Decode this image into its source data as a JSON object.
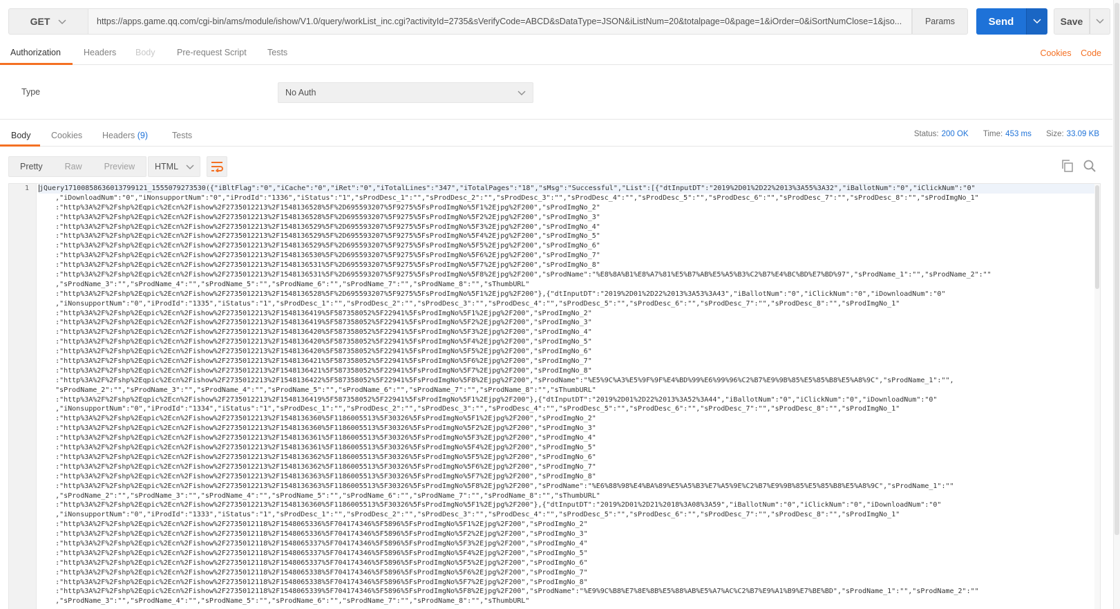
{
  "request": {
    "method": "GET",
    "url": "https://apps.game.qq.com/cgi-bin/ams/module/ishow/V1.0/query/workList_inc.cgi?activityId=2735&sVerifyCode=ABCD&sDataType=JSON&iListNum=20&totalpage=0&page=1&iOrder=0&iSortNumClose=1&jso...",
    "params_label": "Params",
    "send_label": "Send",
    "save_label": "Save"
  },
  "request_tabs": {
    "authorization": "Authorization",
    "headers": "Headers",
    "body": "Body",
    "prerequest": "Pre-request Script",
    "tests": "Tests",
    "cookies_link": "Cookies",
    "code_link": "Code"
  },
  "auth": {
    "type_label": "Type",
    "type_value": "No Auth"
  },
  "response_tabs": {
    "body": "Body",
    "cookies": "Cookies",
    "headers": "Headers",
    "headers_count": "(9)",
    "tests": "Tests"
  },
  "status": {
    "status_label": "Status:",
    "status_value": "200 OK",
    "time_label": "Time:",
    "time_value": "453 ms",
    "size_label": "Size:",
    "size_value": "33.09 KB"
  },
  "view": {
    "pretty": "Pretty",
    "raw": "Raw",
    "preview": "Preview",
    "language": "HTML"
  },
  "editor": {
    "line_number": "1",
    "lines": [
      "jQuery17100858636013799121_1555079273530({\"iBltFlag\":\"0\",\"iCache\":\"0\",\"iRet\":\"0\",\"iTotalLines\":\"347\",\"iTotalPages\":\"18\",\"sMsg\":\"Successful\",\"List\":[{\"dtInputDT\":\"2019%2D01%2D22%2013%3A55%3A32\",\"iBallotNum\":\"0\",\"iClickNum\":\"0\"",
      "    ,\"iDownloadNum\":\"0\",\"iNonsupportNum\":\"0\",\"iProdId\":\"1336\",\"iStatus\":\"1\",\"sProdDesc_1\":\"\",\"sProdDesc_2\":\"\",\"sProdDesc_3\":\"\",\"sProdDesc_4\":\"\",\"sProdDesc_5\":\"\",\"sProdDesc_6\":\"\",\"sProdDesc_7\":\"\",\"sProdDesc_8\":\"\",\"sProdImgNo_1\"",
      "    :\"http%3A%2F%2Fshp%2Eqpic%2Ecn%2Fishow%2F2735012213%2F1548136528%5F%2D695593207%5F9275%5FsProdImgNo%5F1%2Ejpg%2F200\",\"sProdImgNo_2\"",
      "    :\"http%3A%2F%2Fshp%2Eqpic%2Ecn%2Fishow%2F2735012213%2F1548136528%5F%2D695593207%5F9275%5FsProdImgNo%5F2%2Ejpg%2F200\",\"sProdImgNo_3\"",
      "    :\"http%3A%2F%2Fshp%2Eqpic%2Ecn%2Fishow%2F2735012213%2F1548136529%5F%2D695593207%5F9275%5FsProdImgNo%5F3%2Ejpg%2F200\",\"sProdImgNo_4\"",
      "    :\"http%3A%2F%2Fshp%2Eqpic%2Ecn%2Fishow%2F2735012213%2F1548136529%5F%2D695593207%5F9275%5FsProdImgNo%5F4%2Ejpg%2F200\",\"sProdImgNo_5\"",
      "    :\"http%3A%2F%2Fshp%2Eqpic%2Ecn%2Fishow%2F2735012213%2F1548136529%5F%2D695593207%5F9275%5FsProdImgNo%5F5%2Ejpg%2F200\",\"sProdImgNo_6\"",
      "    :\"http%3A%2F%2Fshp%2Eqpic%2Ecn%2Fishow%2F2735012213%2F1548136530%5F%2D695593207%5F9275%5FsProdImgNo%5F6%2Ejpg%2F200\",\"sProdImgNo_7\"",
      "    :\"http%3A%2F%2Fshp%2Eqpic%2Ecn%2Fishow%2F2735012213%2F1548136531%5F%2D695593207%5F9275%5FsProdImgNo%5F7%2Ejpg%2F200\",\"sProdImgNo_8\"",
      "    :\"http%3A%2F%2Fshp%2Eqpic%2Ecn%2Fishow%2F2735012213%2F1548136531%5F%2D695593207%5F9275%5FsProdImgNo%5F8%2Ejpg%2F200\",\"sProdName\":\"%E8%8A%B1%E8%A7%81%E5%B7%AB%E5%A5%B3%C2%B7%E4%BC%BD%E7%BD%97\",\"sProdName_1\":\"\",\"sProdName_2\":\"\"",
      "    ,\"sProdName_3\":\"\",\"sProdName_4\":\"\",\"sProdName_5\":\"\",\"sProdName_6\":\"\",\"sProdName_7\":\"\",\"sProdName_8\":\"\",\"sThumbURL\"",
      "    :\"http%3A%2F%2Fshp%2Eqpic%2Ecn%2Fishow%2F2735012213%2F1548136528%5F%2D695593207%5F9275%5FsProdImgNo%5F1%2Ejpg%2F200\"},{\"dtInputDT\":\"2019%2D01%2D22%2013%3A53%3A43\",\"iBallotNum\":\"0\",\"iClickNum\":\"0\",\"iDownloadNum\":\"0\"",
      "    ,\"iNonsupportNum\":\"0\",\"iProdId\":\"1335\",\"iStatus\":\"1\",\"sProdDesc_1\":\"\",\"sProdDesc_2\":\"\",\"sProdDesc_3\":\"\",\"sProdDesc_4\":\"\",\"sProdDesc_5\":\"\",\"sProdDesc_6\":\"\",\"sProdDesc_7\":\"\",\"sProdDesc_8\":\"\",\"sProdImgNo_1\"",
      "    :\"http%3A%2F%2Fshp%2Eqpic%2Ecn%2Fishow%2F2735012213%2F1548136419%5F587358052%5F22941%5FsProdImgNo%5F1%2Ejpg%2F200\",\"sProdImgNo_2\"",
      "    :\"http%3A%2F%2Fshp%2Eqpic%2Ecn%2Fishow%2F2735012213%2F1548136419%5F587358052%5F22941%5FsProdImgNo%5F2%2Ejpg%2F200\",\"sProdImgNo_3\"",
      "    :\"http%3A%2F%2Fshp%2Eqpic%2Ecn%2Fishow%2F2735012213%2F1548136420%5F587358052%5F22941%5FsProdImgNo%5F3%2Ejpg%2F200\",\"sProdImgNo_4\"",
      "    :\"http%3A%2F%2Fshp%2Eqpic%2Ecn%2Fishow%2F2735012213%2F1548136420%5F587358052%5F22941%5FsProdImgNo%5F4%2Ejpg%2F200\",\"sProdImgNo_5\"",
      "    :\"http%3A%2F%2Fshp%2Eqpic%2Ecn%2Fishow%2F2735012213%2F1548136420%5F587358052%5F22941%5FsProdImgNo%5F5%2Ejpg%2F200\",\"sProdImgNo_6\"",
      "    :\"http%3A%2F%2Fshp%2Eqpic%2Ecn%2Fishow%2F2735012213%2F1548136421%5F587358052%5F22941%5FsProdImgNo%5F6%2Ejpg%2F200\",\"sProdImgNo_7\"",
      "    :\"http%3A%2F%2Fshp%2Eqpic%2Ecn%2Fishow%2F2735012213%2F1548136421%5F587358052%5F22941%5FsProdImgNo%5F7%2Ejpg%2F200\",\"sProdImgNo_8\"",
      "    :\"http%3A%2F%2Fshp%2Eqpic%2Ecn%2Fishow%2F2735012213%2F1548136422%5F587358052%5F22941%5FsProdImgNo%5F8%2Ejpg%2F200\",\"sProdName\":\"%E5%9C%A3%E5%9F%9F%E4%BD%99%E6%99%96%C2%B7%E9%9B%85%E5%85%B8%E5%A8%9C\",\"sProdName_1\":\"\",",
      "    \"sProdName_2\":\"\",\"sProdName_3\":\"\",\"sProdName_4\":\"\",\"sProdName_5\":\"\",\"sProdName_6\":\"\",\"sProdName_7\":\"\",\"sProdName_8\":\"\",\"sThumbURL\"",
      "    :\"http%3A%2F%2Fshp%2Eqpic%2Ecn%2Fishow%2F2735012213%2F1548136419%5F587358052%5F22941%5FsProdImgNo%5F1%2Ejpg%2F200\"},{\"dtInputDT\":\"2019%2D01%2D22%2013%3A52%3A44\",\"iBallotNum\":\"0\",\"iClickNum\":\"0\",\"iDownloadNum\":\"0\"",
      "    ,\"iNonsupportNum\":\"0\",\"iProdId\":\"1334\",\"iStatus\":\"1\",\"sProdDesc_1\":\"\",\"sProdDesc_2\":\"\",\"sProdDesc_3\":\"\",\"sProdDesc_4\":\"\",\"sProdDesc_5\":\"\",\"sProdDesc_6\":\"\",\"sProdDesc_7\":\"\",\"sProdDesc_8\":\"\",\"sProdImgNo_1\"",
      "    :\"http%3A%2F%2Fshp%2Eqpic%2Ecn%2Fishow%2F2735012213%2F1548136360%5F1186005513%5F30326%5FsProdImgNo%5F1%2Ejpg%2F200\",\"sProdImgNo_2\"",
      "    :\"http%3A%2F%2Fshp%2Eqpic%2Ecn%2Fishow%2F2735012213%2F1548136360%5F1186005513%5F30326%5FsProdImgNo%5F2%2Ejpg%2F200\",\"sProdImgNo_3\"",
      "    :\"http%3A%2F%2Fshp%2Eqpic%2Ecn%2Fishow%2F2735012213%2F1548136361%5F1186005513%5F30326%5FsProdImgNo%5F3%2Ejpg%2F200\",\"sProdImgNo_4\"",
      "    :\"http%3A%2F%2Fshp%2Eqpic%2Ecn%2Fishow%2F2735012213%2F1548136361%5F1186005513%5F30326%5FsProdImgNo%5F4%2Ejpg%2F200\",\"sProdImgNo_5\"",
      "    :\"http%3A%2F%2Fshp%2Eqpic%2Ecn%2Fishow%2F2735012213%2F1548136362%5F1186005513%5F30326%5FsProdImgNo%5F5%2Ejpg%2F200\",\"sProdImgNo_6\"",
      "    :\"http%3A%2F%2Fshp%2Eqpic%2Ecn%2Fishow%2F2735012213%2F1548136362%5F1186005513%5F30326%5FsProdImgNo%5F6%2Ejpg%2F200\",\"sProdImgNo_7\"",
      "    :\"http%3A%2F%2Fshp%2Eqpic%2Ecn%2Fishow%2F2735012213%2F1548136363%5F1186005513%5F30326%5FsProdImgNo%5F7%2Ejpg%2F200\",\"sProdImgNo_8\"",
      "    :\"http%3A%2F%2Fshp%2Eqpic%2Ecn%2Fishow%2F2735012213%2F1548136363%5F1186005513%5F30326%5FsProdImgNo%5F8%2Ejpg%2F200\",\"sProdName\":\"%E6%88%98%E4%BA%89%E5%A5%B3%E7%A5%9E%C2%B7%E9%9B%85%E5%85%B8%E5%A8%9C\",\"sProdName_1\":\"\"",
      "    ,\"sProdName_2\":\"\",\"sProdName_3\":\"\",\"sProdName_4\":\"\",\"sProdName_5\":\"\",\"sProdName_6\":\"\",\"sProdName_7\":\"\",\"sProdName_8\":\"\",\"sThumbURL\"",
      "    :\"http%3A%2F%2Fshp%2Eqpic%2Ecn%2Fishow%2F2735012213%2F1548136360%5F1186005513%5F30326%5FsProdImgNo%5F1%2Ejpg%2F200\"},{\"dtInputDT\":\"2019%2D01%2D21%2018%3A08%3A59\",\"iBallotNum\":\"0\",\"iClickNum\":\"0\",\"iDownloadNum\":\"0\"",
      "    ,\"iNonsupportNum\":\"0\",\"iProdId\":\"1333\",\"iStatus\":\"1\",\"sProdDesc_1\":\"\",\"sProdDesc_2\":\"\",\"sProdDesc_3\":\"\",\"sProdDesc_4\":\"\",\"sProdDesc_5\":\"\",\"sProdDesc_6\":\"\",\"sProdDesc_7\":\"\",\"sProdDesc_8\":\"\",\"sProdImgNo_1\"",
      "    :\"http%3A%2F%2Fshp%2Eqpic%2Ecn%2Fishow%2F2735012118%2F1548065336%5F704174346%5F5896%5FsProdImgNo%5F1%2Ejpg%2F200\",\"sProdImgNo_2\"",
      "    :\"http%3A%2F%2Fshp%2Eqpic%2Ecn%2Fishow%2F2735012118%2F1548065336%5F704174346%5F5896%5FsProdImgNo%5F2%2Ejpg%2F200\",\"sProdImgNo_3\"",
      "    :\"http%3A%2F%2Fshp%2Eqpic%2Ecn%2Fishow%2F2735012118%2F1548065337%5F704174346%5F5896%5FsProdImgNo%5F3%2Ejpg%2F200\",\"sProdImgNo_4\"",
      "    :\"http%3A%2F%2Fshp%2Eqpic%2Ecn%2Fishow%2F2735012118%2F1548065337%5F704174346%5F5896%5FsProdImgNo%5F4%2Ejpg%2F200\",\"sProdImgNo_5\"",
      "    :\"http%3A%2F%2Fshp%2Eqpic%2Ecn%2Fishow%2F2735012118%2F1548065337%5F704174346%5F5896%5FsProdImgNo%5F5%2Ejpg%2F200\",\"sProdImgNo_6\"",
      "    :\"http%3A%2F%2Fshp%2Eqpic%2Ecn%2Fishow%2F2735012118%2F1548065338%5F704174346%5F5896%5FsProdImgNo%5F6%2Ejpg%2F200\",\"sProdImgNo_7\"",
      "    :\"http%3A%2F%2Fshp%2Eqpic%2Ecn%2Fishow%2F2735012118%2F1548065338%5F704174346%5F5896%5FsProdImgNo%5F7%2Ejpg%2F200\",\"sProdImgNo_8\"",
      "    :\"http%3A%2F%2Fshp%2Eqpic%2Ecn%2Fishow%2F2735012118%2F1548065339%5F704174346%5F5896%5FsProdImgNo%5F8%2Ejpg%2F200\",\"sProdName\":\"%E9%9C%B8%E7%8E%8B%E5%88%AB%E5%A7%AC%C2%B7%E9%A1%B9%E7%BE%BD\",\"sProdName_1\":\"\",\"sProdName_2\":\"\"",
      "    ,\"sProdName_3\":\"\",\"sProdName_4\":\"\",\"sProdName_5\":\"\",\"sProdName_6\":\"\",\"sProdName_7\":\"\",\"sProdName_8\":\"\",\"sThumbURL\""
    ]
  },
  "icons": {
    "method_chevron": "chevron-down-icon",
    "send_chevron": "chevron-down-icon",
    "save_chevron": "chevron-down-icon",
    "wrap": "wrap-lines-icon",
    "copy": "copy-icon",
    "search": "search-icon"
  },
  "colors": {
    "accent": "#f47023",
    "primary": "#1e72d8"
  }
}
